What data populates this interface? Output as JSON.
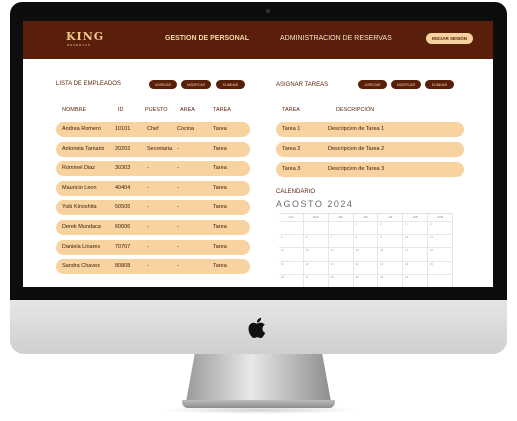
{
  "header": {
    "logo": "KING",
    "logo_sub": "RESERVAS",
    "nav": [
      "GESTION DE PERSONAL",
      "ADMINISTRACION DE RESERVAS"
    ],
    "login_label": "INICIAR SESIÓN"
  },
  "employees": {
    "title": "LISTA DE EMPLEADOS",
    "buttons": [
      "AGREGAR",
      "MODIFICAR",
      "ELIMINAR"
    ],
    "columns": [
      "NOMBRE",
      "ID",
      "PUESTO",
      "AREA",
      "TAREA"
    ],
    "rows": [
      [
        "Andrea Romero",
        "10101",
        "Chef",
        "Cocina",
        "Tarea"
      ],
      [
        "Antonela Tamariz",
        "20202",
        "Secretaria",
        "-",
        "Tarea"
      ],
      [
        "Rommel Diaz",
        "30303",
        "-",
        "-",
        "Tarea"
      ],
      [
        "Mauricio Leon",
        "40404",
        "-",
        "-",
        "Tarea"
      ],
      [
        "Yuki Kinoshita",
        "50505",
        "-",
        "-",
        "Tarea"
      ],
      [
        "Derek Mundaca",
        "60606",
        "-",
        "-",
        "Tarea"
      ],
      [
        "Daniela Linares",
        "70707",
        "-",
        "-",
        "Tarea"
      ],
      [
        "Sandra Chavez",
        "80808",
        "-",
        "-",
        "Tarea"
      ]
    ]
  },
  "tasks": {
    "title": "ASIGNAR TAREAS",
    "buttons": [
      "AGREGAR",
      "MODIFICAR",
      "ELIMINAR"
    ],
    "columns": [
      "TAREA",
      "DESCRIPCIÓN"
    ],
    "rows": [
      [
        "Tarea 1",
        "Descripcion de Tarea 1"
      ],
      [
        "Tarea 2",
        "Descripcion de Tarea 2"
      ],
      [
        "Tarea 3",
        "Descripcion de Tarea 3"
      ]
    ]
  },
  "calendar": {
    "title": "CALENDARIO",
    "month": "AGOSTO 2024",
    "weekdays": [
      "LUN",
      "MAR",
      "MIE",
      "JUE",
      "VIE",
      "SAB",
      "DOM"
    ],
    "weeks": [
      [
        "",
        "",
        "",
        "1",
        "2",
        "3",
        "4"
      ],
      [
        "5",
        "6",
        "7",
        "8",
        "9",
        "10",
        "11"
      ],
      [
        "12",
        "13",
        "14",
        "15",
        "16",
        "17",
        "18"
      ],
      [
        "19",
        "20",
        "21",
        "22",
        "23",
        "24",
        "25"
      ],
      [
        "26",
        "27",
        "28",
        "29",
        "30",
        "31",
        ""
      ]
    ]
  },
  "icons": {
    "device_logo": "apple-icon"
  },
  "colors": {
    "brand": "#5a1f0a",
    "accent": "#f8d3a0",
    "logo": "#f1c98a"
  }
}
